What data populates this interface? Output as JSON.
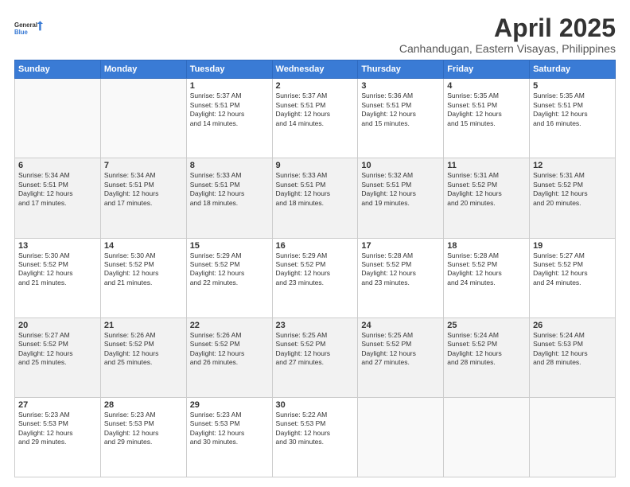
{
  "header": {
    "logo_general": "General",
    "logo_blue": "Blue",
    "month": "April 2025",
    "location": "Canhandugan, Eastern Visayas, Philippines"
  },
  "days_of_week": [
    "Sunday",
    "Monday",
    "Tuesday",
    "Wednesday",
    "Thursday",
    "Friday",
    "Saturday"
  ],
  "weeks": [
    [
      {
        "day": "",
        "info": ""
      },
      {
        "day": "",
        "info": ""
      },
      {
        "day": "1",
        "info": "Sunrise: 5:37 AM\nSunset: 5:51 PM\nDaylight: 12 hours\nand 14 minutes."
      },
      {
        "day": "2",
        "info": "Sunrise: 5:37 AM\nSunset: 5:51 PM\nDaylight: 12 hours\nand 14 minutes."
      },
      {
        "day": "3",
        "info": "Sunrise: 5:36 AM\nSunset: 5:51 PM\nDaylight: 12 hours\nand 15 minutes."
      },
      {
        "day": "4",
        "info": "Sunrise: 5:35 AM\nSunset: 5:51 PM\nDaylight: 12 hours\nand 15 minutes."
      },
      {
        "day": "5",
        "info": "Sunrise: 5:35 AM\nSunset: 5:51 PM\nDaylight: 12 hours\nand 16 minutes."
      }
    ],
    [
      {
        "day": "6",
        "info": "Sunrise: 5:34 AM\nSunset: 5:51 PM\nDaylight: 12 hours\nand 17 minutes."
      },
      {
        "day": "7",
        "info": "Sunrise: 5:34 AM\nSunset: 5:51 PM\nDaylight: 12 hours\nand 17 minutes."
      },
      {
        "day": "8",
        "info": "Sunrise: 5:33 AM\nSunset: 5:51 PM\nDaylight: 12 hours\nand 18 minutes."
      },
      {
        "day": "9",
        "info": "Sunrise: 5:33 AM\nSunset: 5:51 PM\nDaylight: 12 hours\nand 18 minutes."
      },
      {
        "day": "10",
        "info": "Sunrise: 5:32 AM\nSunset: 5:51 PM\nDaylight: 12 hours\nand 19 minutes."
      },
      {
        "day": "11",
        "info": "Sunrise: 5:31 AM\nSunset: 5:52 PM\nDaylight: 12 hours\nand 20 minutes."
      },
      {
        "day": "12",
        "info": "Sunrise: 5:31 AM\nSunset: 5:52 PM\nDaylight: 12 hours\nand 20 minutes."
      }
    ],
    [
      {
        "day": "13",
        "info": "Sunrise: 5:30 AM\nSunset: 5:52 PM\nDaylight: 12 hours\nand 21 minutes."
      },
      {
        "day": "14",
        "info": "Sunrise: 5:30 AM\nSunset: 5:52 PM\nDaylight: 12 hours\nand 21 minutes."
      },
      {
        "day": "15",
        "info": "Sunrise: 5:29 AM\nSunset: 5:52 PM\nDaylight: 12 hours\nand 22 minutes."
      },
      {
        "day": "16",
        "info": "Sunrise: 5:29 AM\nSunset: 5:52 PM\nDaylight: 12 hours\nand 23 minutes."
      },
      {
        "day": "17",
        "info": "Sunrise: 5:28 AM\nSunset: 5:52 PM\nDaylight: 12 hours\nand 23 minutes."
      },
      {
        "day": "18",
        "info": "Sunrise: 5:28 AM\nSunset: 5:52 PM\nDaylight: 12 hours\nand 24 minutes."
      },
      {
        "day": "19",
        "info": "Sunrise: 5:27 AM\nSunset: 5:52 PM\nDaylight: 12 hours\nand 24 minutes."
      }
    ],
    [
      {
        "day": "20",
        "info": "Sunrise: 5:27 AM\nSunset: 5:52 PM\nDaylight: 12 hours\nand 25 minutes."
      },
      {
        "day": "21",
        "info": "Sunrise: 5:26 AM\nSunset: 5:52 PM\nDaylight: 12 hours\nand 25 minutes."
      },
      {
        "day": "22",
        "info": "Sunrise: 5:26 AM\nSunset: 5:52 PM\nDaylight: 12 hours\nand 26 minutes."
      },
      {
        "day": "23",
        "info": "Sunrise: 5:25 AM\nSunset: 5:52 PM\nDaylight: 12 hours\nand 27 minutes."
      },
      {
        "day": "24",
        "info": "Sunrise: 5:25 AM\nSunset: 5:52 PM\nDaylight: 12 hours\nand 27 minutes."
      },
      {
        "day": "25",
        "info": "Sunrise: 5:24 AM\nSunset: 5:52 PM\nDaylight: 12 hours\nand 28 minutes."
      },
      {
        "day": "26",
        "info": "Sunrise: 5:24 AM\nSunset: 5:53 PM\nDaylight: 12 hours\nand 28 minutes."
      }
    ],
    [
      {
        "day": "27",
        "info": "Sunrise: 5:23 AM\nSunset: 5:53 PM\nDaylight: 12 hours\nand 29 minutes."
      },
      {
        "day": "28",
        "info": "Sunrise: 5:23 AM\nSunset: 5:53 PM\nDaylight: 12 hours\nand 29 minutes."
      },
      {
        "day": "29",
        "info": "Sunrise: 5:23 AM\nSunset: 5:53 PM\nDaylight: 12 hours\nand 30 minutes."
      },
      {
        "day": "30",
        "info": "Sunrise: 5:22 AM\nSunset: 5:53 PM\nDaylight: 12 hours\nand 30 minutes."
      },
      {
        "day": "",
        "info": ""
      },
      {
        "day": "",
        "info": ""
      },
      {
        "day": "",
        "info": ""
      }
    ]
  ]
}
